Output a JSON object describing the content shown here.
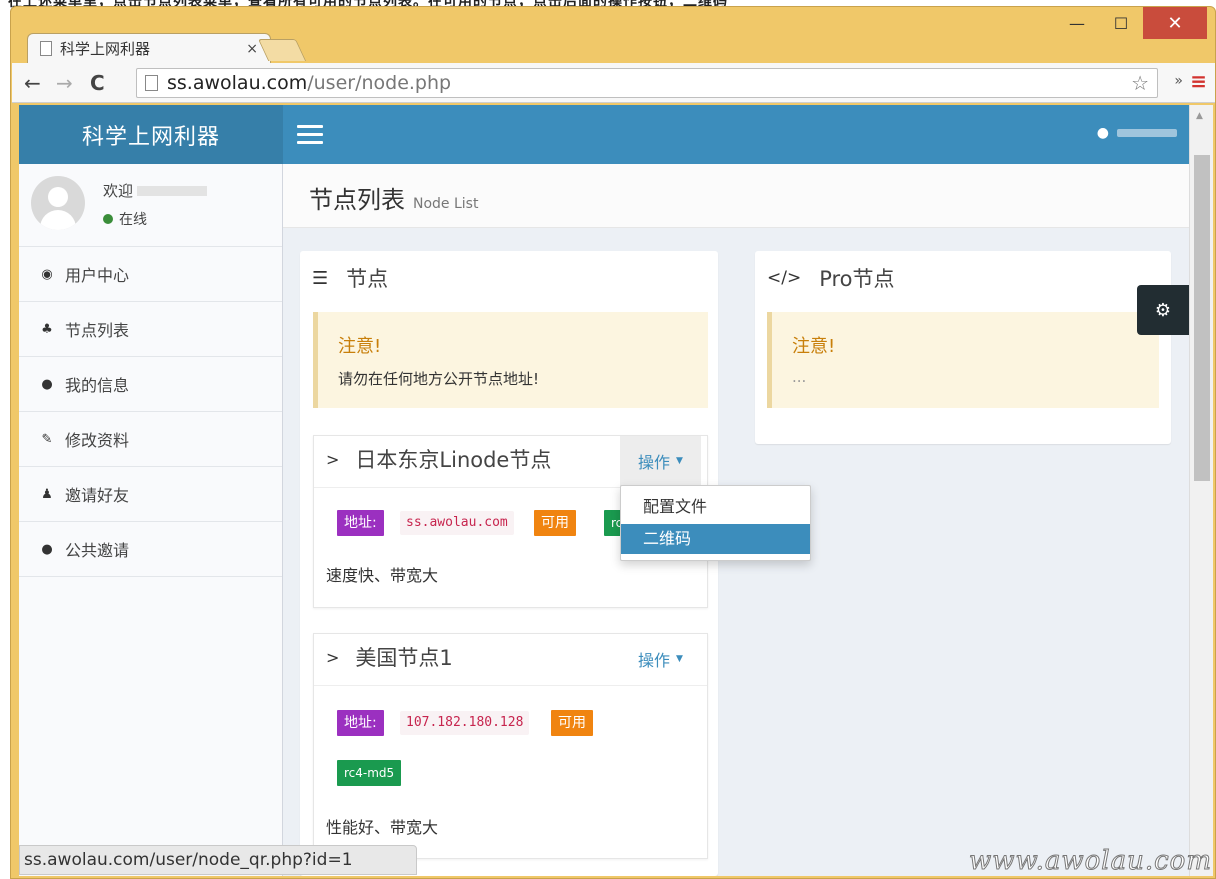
{
  "instruction_strip": "在上述菜单里，点击节点列表菜单，查看所有可用的节点列表。在可用的节点，点击后面的操作按钮，二维码",
  "browser": {
    "tab_title": "科学上网利器",
    "tab_close": "×",
    "url_host": "ss.awolau.com",
    "url_path": "/user/node.php",
    "status_url": "ss.awolau.com/user/node_qr.php?id=1"
  },
  "window_controls": {
    "minimize": "—",
    "maximize": "☐",
    "close": "✕"
  },
  "app": {
    "logo": "科学上网利器",
    "user_panel": {
      "welcome": "欢迎",
      "status": "在线"
    },
    "sidebar": [
      {
        "icon": "dashboard-icon",
        "glyph": "◉",
        "label": "用户中心"
      },
      {
        "icon": "sitemap-icon",
        "glyph": "♣",
        "label": "节点列表"
      },
      {
        "icon": "user-icon",
        "glyph": "●",
        "label": "我的信息"
      },
      {
        "icon": "pencil-icon",
        "glyph": "✎",
        "label": "修改资料"
      },
      {
        "icon": "users-icon",
        "glyph": "♟",
        "label": "邀请好友"
      },
      {
        "icon": "user-icon",
        "glyph": "●",
        "label": "公共邀请"
      }
    ],
    "page_title": "节点列表",
    "page_subtitle": "Node List"
  },
  "nodes_box": {
    "title": "节点",
    "notice": {
      "title": "注意!",
      "text": "请勿在任何地方公开节点地址!"
    },
    "nodes": [
      {
        "name": "日本东京Linode节点",
        "action": "操作",
        "addr_label": "地址:",
        "addr": "ss.awolau.com",
        "status": "可用",
        "method": "rc4-md5",
        "desc": "速度快、带宽大"
      },
      {
        "name": "美国节点1",
        "action": "操作",
        "addr_label": "地址:",
        "addr": "107.182.180.128",
        "status": "可用",
        "method": "rc4-md5",
        "desc": "性能好、带宽大"
      }
    ]
  },
  "pro_box": {
    "title": "Pro节点",
    "notice": {
      "title": "注意!",
      "text": "..."
    }
  },
  "dropdown": {
    "items": [
      "配置文件",
      "二维码"
    ],
    "active_index": 1
  },
  "watermark": "www.awolau.com",
  "colors": {
    "header": "#3c8dbc",
    "logo_bg": "#367fa9",
    "addr_label": "#9b30c0",
    "status_ok": "#f08410",
    "method": "#1a9a4f"
  }
}
